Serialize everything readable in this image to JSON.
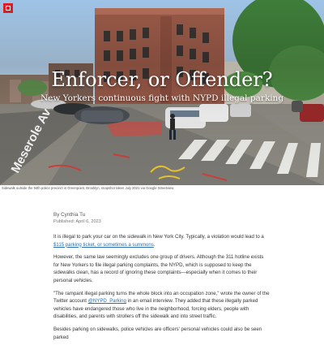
{
  "brand": {
    "accent": "#d9202a"
  },
  "hero": {
    "title": "Enforcer, or Offender?",
    "subtitle": "New Yorkers continuous fight with NYPD illegal parking",
    "street_sign": "Meserole Av"
  },
  "caption": "Sidewalk outside the 94th police precinct in Greenpoint, Brooklyn, snapshot taken July 2021 via Google Streetview",
  "article": {
    "author": "By Cynthia Tu",
    "published": "Published: April 6, 2023",
    "p1_before": "It is illegal to park your car on the sidewalk in New York City. Typically, a violation would lead to a ",
    "p1_link": "$115 parking ticket, or sometimes a summons",
    "p1_after": ".",
    "p2": "However, the same law seemingly excludes one group of drivers. Although the 311 hotline exists for New Yorkers to file illegal parking complaints, the NYPD, which is supposed to keep the sidewalks clean, has a record of ignoring these complaints—especially when it comes to their personal vehicles.",
    "p3_before": "\"The rampant illegal parking turns the whole block into an occupation zone,\" wrote the owner of the Twitter account ",
    "p3_link": "@NYPD_Parking",
    "p3_after": " in an email interview. They added that these illegally parked vehicles have endangered those who live in the neighborhood, forcing elders, people with disabilities, and parents with strollers off the sidewalk and into street traffic.",
    "p4": "Besides parking on sidewalks, police vehicles are officers' personal vehicles could also be seen parked"
  }
}
